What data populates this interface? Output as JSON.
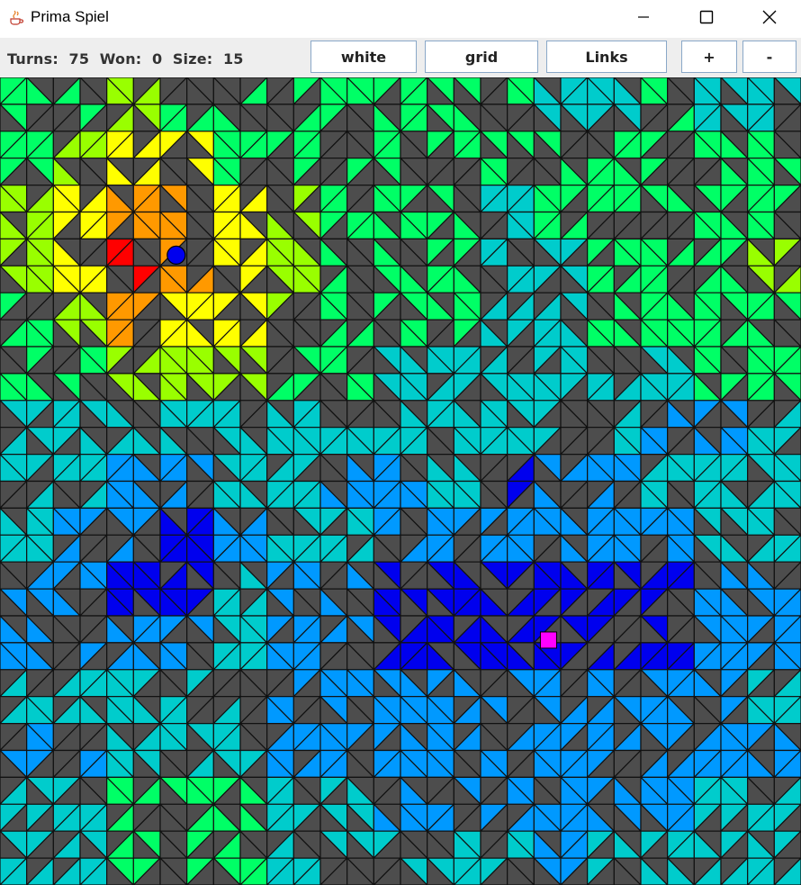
{
  "window": {
    "title": "Prima Spiel"
  },
  "status": {
    "turns_label": "Turns:",
    "turns": "75",
    "won_label": "Won:",
    "won": "0",
    "size_label": "Size:",
    "size": "15"
  },
  "buttons": {
    "white": "white",
    "grid": "grid",
    "links": "Links",
    "plus": "+",
    "minus": "-"
  },
  "board": {
    "cols": 15,
    "rows": 15,
    "wall_color": "#4d4d4d",
    "palette": {
      "red": "#ff0000",
      "orange": "#ff9900",
      "yellow": "#ffff00",
      "lime": "#99ff00",
      "green": "#00ff66",
      "cyan": "#00cccc",
      "azure": "#0099ff",
      "blue": "#0000ee",
      "magenta": "#ff00ff",
      "player": "#0000ee"
    },
    "region_rows": [
      "gglggGGGGGCCgCC",
      "glyygGGGGGGGGGG",
      "lyooylGGGCGGGGG",
      "lyrOylGGGCCGGGl",
      "gloyylGGGCCGGGG",
      "gglllggCCCCCCGG",
      "CCCCCCCCCCCCaaC",
      "CCaaCCaaCbaaCCC",
      "CaabaCCaaaaaaCC",
      "aabbCaabbbbbbaa",
      "aaaaCaabbbbbbaa",
      "CCCCCaaaaaaaaaC",
      "aaCCCaaaaaaaaaa",
      "CCgggCCaaaaaaCC",
      "CCgggCCCCCaCCCC"
    ],
    "player": {
      "col": 3,
      "row": 3,
      "color": "player"
    },
    "target": {
      "col": 10,
      "row": 10,
      "color": "magenta"
    }
  }
}
